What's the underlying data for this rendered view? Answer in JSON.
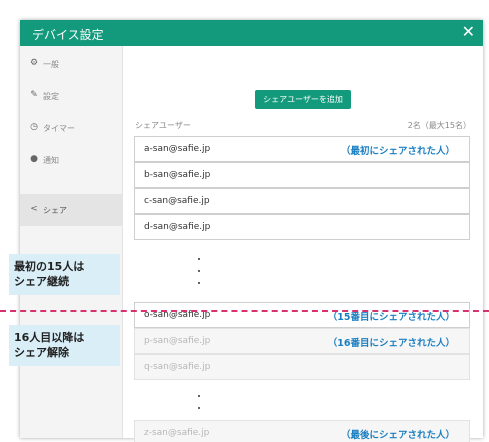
{
  "dialog": {
    "title": "デバイス設定",
    "close_icon": "close-icon"
  },
  "sidebar": {
    "items": [
      {
        "icon": "gear-icon",
        "glyph": "⚙",
        "label": "一般"
      },
      {
        "icon": "wrench-icon",
        "glyph": "✎",
        "label": "設定"
      },
      {
        "icon": "clock-icon",
        "glyph": "◷",
        "label": "タイマー"
      },
      {
        "icon": "bell-icon",
        "glyph": "●",
        "label": "通知"
      },
      {
        "icon": "share-icon",
        "glyph": "<",
        "label": "シェア",
        "active": true
      }
    ]
  },
  "main": {
    "add_button": "シェアユーザーを追加",
    "list_header": {
      "title": "シェアユーザー",
      "count": "2名（最大15名）"
    },
    "users": [
      {
        "email": "a-san@safie.jp",
        "note": "（最初にシェアされた人）"
      },
      {
        "email": "b-san@safie.jp",
        "note": ""
      },
      {
        "email": "c-san@safie.jp",
        "note": ""
      },
      {
        "email": "d-san@safie.jp",
        "note": ""
      },
      {
        "email": "o-san@safie.jp",
        "note": "（15番目にシェアされた人）"
      },
      {
        "email": "p-san@safie.jp",
        "note": "（16番目にシェアされた人）",
        "removed": true
      },
      {
        "email": "q-san@safie.jp",
        "note": "",
        "removed": true
      },
      {
        "email": "z-san@safie.jp",
        "note": "（最後にシェアされた人）",
        "removed": true
      }
    ]
  },
  "annotations": {
    "keep": {
      "line1": "最初の15人は",
      "line2": "シェア継続"
    },
    "remove": {
      "line1": "16人目以降は",
      "line2": "シェア解除"
    }
  },
  "colors": {
    "accent": "#139a7c",
    "note": "#1a7fc0",
    "cut_line": "#d9306e",
    "callout_bg": "#daeef7"
  }
}
